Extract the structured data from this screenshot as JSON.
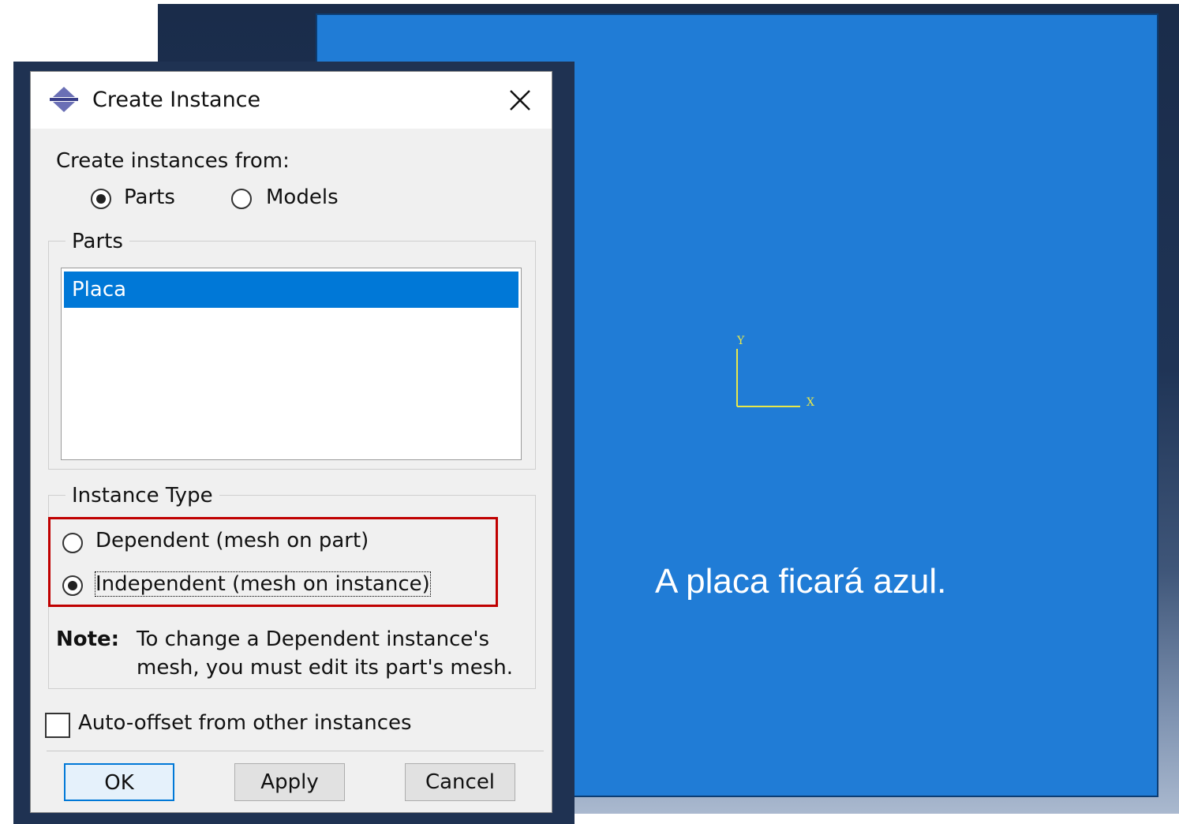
{
  "viewport": {
    "caption": "A placa ficará azul.",
    "triad": {
      "y_label": "Y",
      "x_label": "X",
      "color": "#e8e84a"
    },
    "plate_color": "#207cd6"
  },
  "dialog": {
    "title": "Create Instance",
    "title_icon": "abaqus-instance-icon",
    "close_icon": "close-icon",
    "create_from": {
      "label": "Create instances from:",
      "options": [
        {
          "label": "Parts",
          "selected": true
        },
        {
          "label": "Models",
          "selected": false
        }
      ]
    },
    "parts_group": {
      "title": "Parts",
      "items": [
        {
          "label": "Placa",
          "selected": true
        }
      ]
    },
    "instance_type": {
      "title": "Instance Type",
      "options": [
        {
          "label": "Dependent (mesh on part)",
          "selected": false
        },
        {
          "label": "Independent (mesh on instance)",
          "selected": true
        }
      ],
      "note_label": "Note:",
      "note_line1": "To change a Dependent instance's",
      "note_line2": "mesh, you must edit its part's mesh.",
      "highlight_color": "#c00000"
    },
    "auto_offset": {
      "label": "Auto-offset from other instances",
      "checked": false
    },
    "buttons": {
      "ok": "OK",
      "apply": "Apply",
      "cancel": "Cancel"
    }
  }
}
